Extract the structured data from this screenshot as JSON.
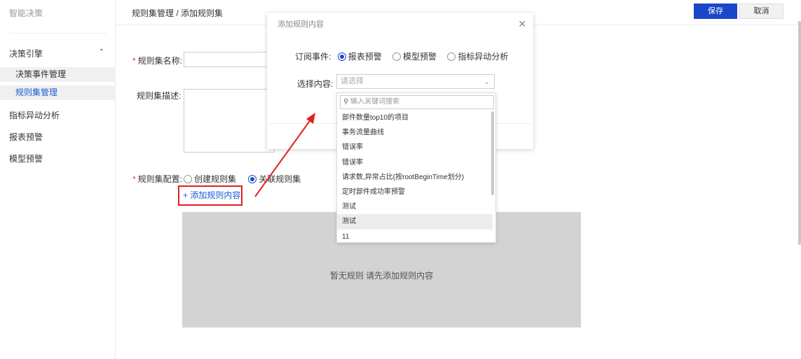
{
  "sidebar": {
    "title": "智能决策",
    "group": "决策引擎",
    "sub_items": [
      "决策事件管理",
      "规则集管理"
    ],
    "items": [
      "指标异动分析",
      "报表预警",
      "模型预警"
    ]
  },
  "header": {
    "breadcrumb": "规则集管理 / 添加规则集",
    "save_label": "保存",
    "cancel_label": "取消"
  },
  "form": {
    "name_label": "规则集名称:",
    "desc_label": "规则集描述:",
    "config_label": "规则集配置:",
    "config_options": [
      "创建规则集",
      "关联规则集"
    ],
    "config_selected": "关联规则集",
    "add_rule_label": "+ 添加规则内容",
    "empty_text": "暂无规则 请先添加规则内容"
  },
  "modal": {
    "title": "添加规则内容",
    "subscribe_label": "订阅事件:",
    "subscribe_options": [
      "报表预警",
      "模型预警",
      "指标异动分析"
    ],
    "subscribe_selected": "报表预警",
    "select_label": "选择内容:",
    "select_placeholder": "请选择"
  },
  "dropdown": {
    "search_placeholder": "输入关键词搜索",
    "items": [
      "部件数量top10的项目",
      "事务流量曲线",
      "错误率",
      "错误率",
      "请求数,异常占比(按rootBeginTime划分)",
      "定时部件成功率预警",
      "测试",
      "测试",
      "11"
    ],
    "hover_index": 7
  },
  "colors": {
    "primary": "#1a47c9",
    "link": "#1a5ad6",
    "annotation": "#e02020"
  }
}
